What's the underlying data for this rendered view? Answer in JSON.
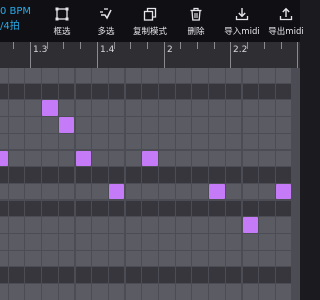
{
  "header": {
    "tempo": "0 BPM",
    "time_signature": "/4拍",
    "accent_color": "#29a9e6"
  },
  "toolbar": {
    "buttons": [
      {
        "id": "box-select",
        "label": "框选",
        "icon": "box-select-icon"
      },
      {
        "id": "multi-select",
        "label": "多选",
        "icon": "multi-select-icon"
      },
      {
        "id": "copy-mode",
        "label": "复制模式",
        "icon": "copy-icon"
      },
      {
        "id": "delete",
        "label": "删除",
        "icon": "trash-icon"
      },
      {
        "id": "import-midi",
        "label": "导入midi",
        "icon": "import-icon"
      },
      {
        "id": "export-midi",
        "label": "导出midi",
        "icon": "export-icon"
      }
    ]
  },
  "ruler": {
    "labels": [
      "1.3",
      "1.4",
      "2",
      "2.2",
      "2"
    ]
  },
  "piano_roll": {
    "note_color": "#c57af8",
    "notes": [
      {
        "row": 2,
        "col": 3
      },
      {
        "row": 3,
        "col": 4
      },
      {
        "row": 5,
        "col": 0
      },
      {
        "row": 5,
        "col": 5
      },
      {
        "row": 5,
        "col": 9
      },
      {
        "row": 7,
        "col": 7
      },
      {
        "row": 7,
        "col": 13
      },
      {
        "row": 7,
        "col": 17
      },
      {
        "row": 9,
        "col": 15
      }
    ]
  }
}
